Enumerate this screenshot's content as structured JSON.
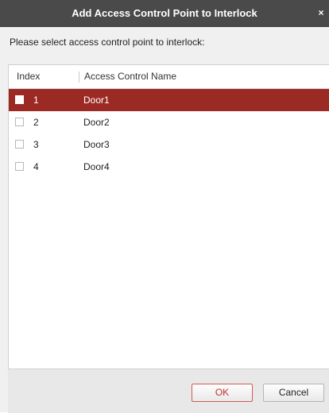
{
  "dialog": {
    "title": "Add Access Control Point to Interlock",
    "close_symbol": "×",
    "prompt": "Please select access control point to interlock:"
  },
  "table": {
    "columns": [
      "Index",
      "Access Control Name"
    ],
    "rows": [
      {
        "index": "1",
        "name": "Door1",
        "selected": true,
        "checked": false
      },
      {
        "index": "2",
        "name": "Door2",
        "selected": false,
        "checked": false
      },
      {
        "index": "3",
        "name": "Door3",
        "selected": false,
        "checked": false
      },
      {
        "index": "4",
        "name": "Door4",
        "selected": false,
        "checked": false
      }
    ]
  },
  "buttons": {
    "ok_label": "OK",
    "cancel_label": "Cancel"
  },
  "colors": {
    "titlebar": "#4a4a4a",
    "selected_row": "#9c2a24",
    "ok_accent": "#c0302a"
  },
  "icons": {
    "close": "close-icon",
    "checkbox": "checkbox-icon"
  }
}
